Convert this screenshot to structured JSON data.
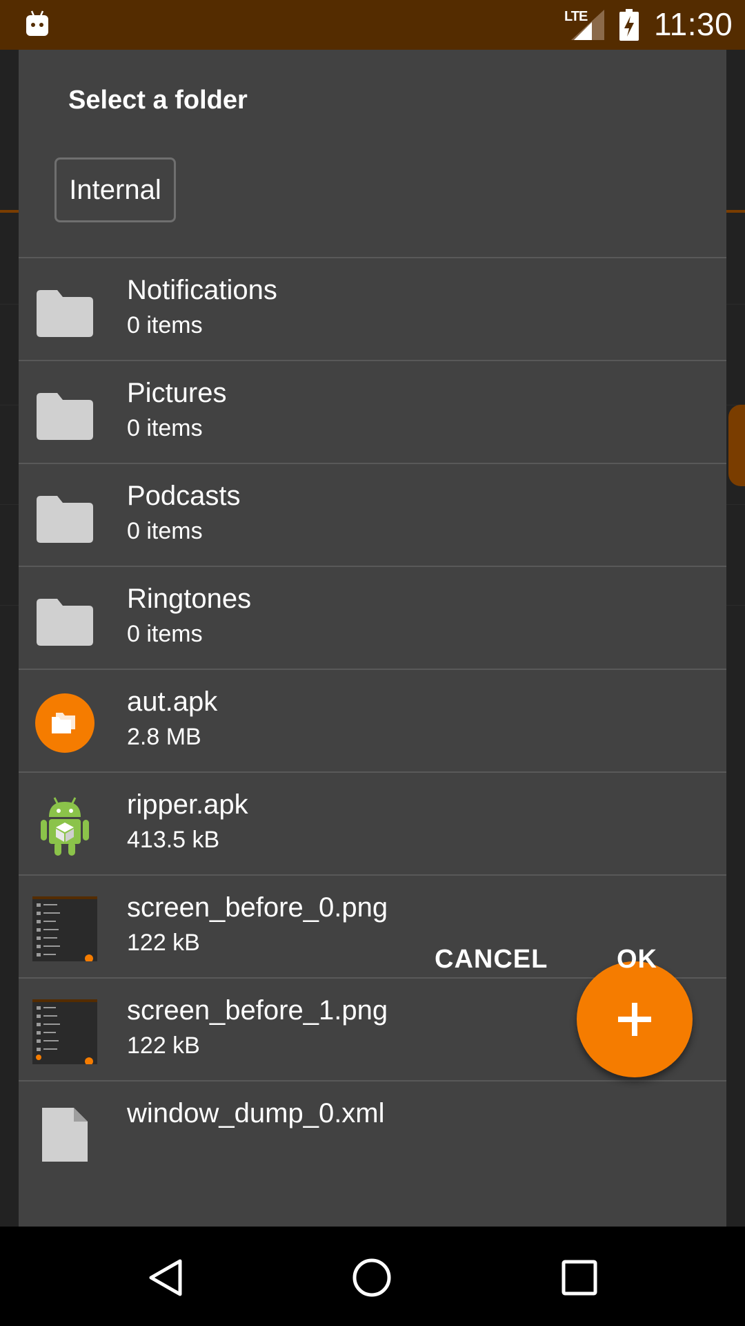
{
  "status_bar": {
    "network": "LTE",
    "time": "11:30",
    "color": "#542c00"
  },
  "dialog": {
    "title": "Select a folder",
    "storage_chip": "Internal",
    "items": [
      {
        "name": "Notifications",
        "sub": "0 items",
        "icon": "folder-icon"
      },
      {
        "name": "Pictures",
        "sub": "0 items",
        "icon": "folder-icon"
      },
      {
        "name": "Podcasts",
        "sub": "0 items",
        "icon": "folder-icon"
      },
      {
        "name": "Ringtones",
        "sub": "0 items",
        "icon": "folder-icon"
      },
      {
        "name": "aut.apk",
        "sub": "2.8 MB",
        "icon": "app-folders-icon"
      },
      {
        "name": "ripper.apk",
        "sub": "413.5 kB",
        "icon": "android-apk-icon"
      },
      {
        "name": "screen_before_0.png",
        "sub": "122 kB",
        "icon": "image-thumbnail"
      },
      {
        "name": "screen_before_1.png",
        "sub": "122 kB",
        "icon": "image-thumbnail"
      },
      {
        "name": "window_dump_0.xml",
        "sub": "",
        "icon": "file-icon"
      }
    ],
    "cancel_label": "CANCEL",
    "ok_label": "OK",
    "fab_icon": "plus-icon",
    "accent_color": "#f57c00"
  },
  "nav_bar": {
    "back_icon": "back-triangle-icon",
    "home_icon": "home-circle-icon",
    "recents_icon": "recents-square-icon"
  }
}
